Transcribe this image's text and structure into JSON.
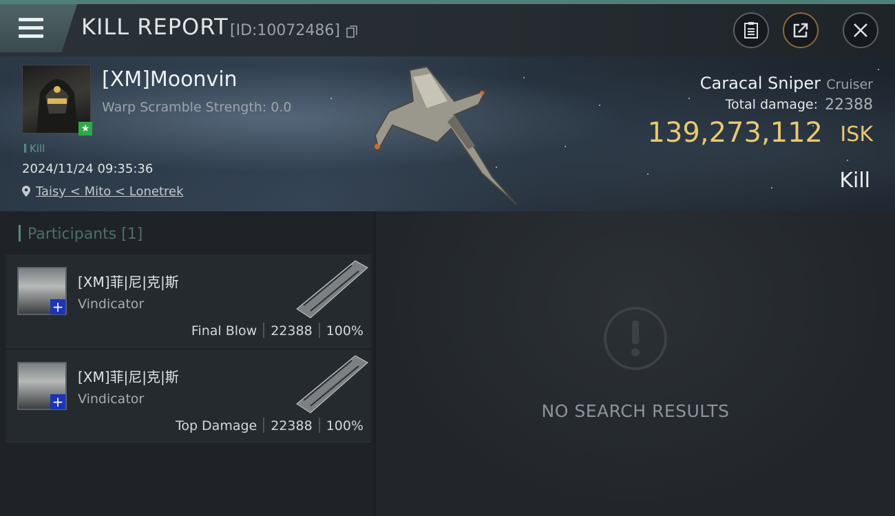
{
  "header": {
    "title": "KILL REPORT",
    "report_id": "[ID:10072486]"
  },
  "victim": {
    "name": "[XM]Moonvin",
    "warp_scramble": "Warp Scramble Strength: 0.0",
    "tag": "Kill",
    "time": "2024/11/24 09:35:36",
    "location": "Taisy < Mito < Lonetrek"
  },
  "loss": {
    "ship_name": "Caracal Sniper",
    "ship_class": "Cruiser",
    "total_damage_label": "Total damage:",
    "total_damage": "22388",
    "isk_value": "139,273,112",
    "isk_unit": "ISK",
    "result": "Kill"
  },
  "participants": {
    "header": "Participants [1]",
    "rows": [
      {
        "name": "[XM]菲|尼|克|斯",
        "ship": "Vindicator",
        "role": "Final Blow",
        "damage": "22388",
        "percent": "100%"
      },
      {
        "name": "[XM]菲|尼|克|斯",
        "ship": "Vindicator",
        "role": "Top Damage",
        "damage": "22388",
        "percent": "100%"
      }
    ]
  },
  "results_panel": {
    "message": "NO SEARCH RESULTS"
  },
  "colors": {
    "accent": "#4e7f79",
    "isk": "#e9c873",
    "badge_green": "#2fa84a",
    "badge_blue": "#1c35b6"
  },
  "icons": [
    "menu-icon",
    "copy-icon",
    "clipboard-icon",
    "share-icon",
    "close-icon",
    "location-pin-icon",
    "alert-icon"
  ]
}
